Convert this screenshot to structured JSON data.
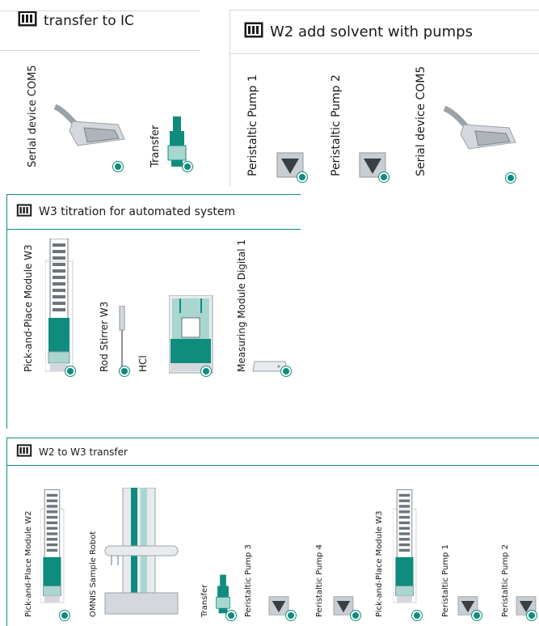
{
  "panels": {
    "transfer_ic": {
      "title": "transfer to IC",
      "devices": [
        "Serial device COM5",
        "Transfer"
      ]
    },
    "w2_solvent": {
      "title": "W2 add solvent with pumps",
      "devices": [
        "Peristaltic Pump 1",
        "Peristaltic Pump 2",
        "Serial device COM5"
      ]
    },
    "w3_titration": {
      "title": "W3 titration for automated system",
      "devices": [
        "Pick-and-Place Module W3",
        "Rod Stirrer W3",
        "HCl",
        "Measuring Module Digital 1"
      ]
    },
    "w2_w3": {
      "title": "W2 to W3 transfer",
      "devices": [
        "Pick-and-Place Module W2",
        "OMNIS Sample Robot",
        "Transfer",
        "Peristaltic Pump 3",
        "Peristaltic Pump 4",
        "Pick-and-Place Module W3",
        "Peristaltic Pump 1",
        "Peristaltic Pump 2"
      ]
    }
  },
  "icons": {
    "panel_header": "workstation-icon",
    "serial": "serial-connector-icon",
    "transfer": "transfer-unit-icon",
    "pump": "peristaltic-pump-icon",
    "pick_place": "pick-and-place-module-icon",
    "stirrer": "rod-stirrer-icon",
    "titrator": "titration-module-icon",
    "measuring": "measuring-module-icon",
    "robot": "sample-robot-icon",
    "status": "status-dot-icon"
  },
  "colors": {
    "accent": "#0f8c7e",
    "accent_light": "#a9d6cf",
    "panel_border": "#d9d9d9"
  }
}
